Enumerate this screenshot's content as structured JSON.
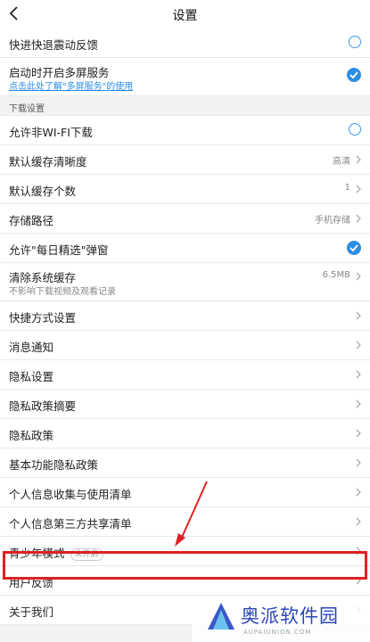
{
  "header": {
    "title": "设置"
  },
  "colors": {
    "accent": "#2d8fe3",
    "highlight": "#e02020"
  },
  "rows": [
    {
      "label": "快进快退震动反馈",
      "control": "circle"
    },
    {
      "label": "启动时开启多屏服务",
      "sub": "点击此处了解\"多屏服务\"的使用",
      "control": "check"
    },
    {
      "section": "下载设置"
    },
    {
      "label": "允许非WI-FI下载",
      "control": "circle"
    },
    {
      "label": "默认缓存清晰度",
      "value": "高清",
      "control": "chevron"
    },
    {
      "label": "默认缓存个数",
      "value": "1",
      "control": "chevron"
    },
    {
      "label": "存储路径",
      "value": "手机存储",
      "control": "chevron"
    },
    {
      "label": "允许\"每日精选\"弹窗",
      "control": "check"
    },
    {
      "label": "清除系统缓存",
      "sub": "不影响下载视频及观看记录",
      "value": "6.5MB",
      "control": "chevron"
    },
    {
      "label": "快捷方式设置",
      "control": "chevron"
    },
    {
      "label": "消息通知",
      "control": "chevron"
    },
    {
      "label": "隐私设置",
      "control": "chevron"
    },
    {
      "label": "隐私政策摘要",
      "control": "chevron"
    },
    {
      "label": "隐私政策",
      "control": "chevron"
    },
    {
      "label": "基本功能隐私政策",
      "control": "chevron"
    },
    {
      "label": "个人信息收集与使用清单",
      "control": "chevron"
    },
    {
      "label": "个人信息第三方共享清单",
      "control": "chevron"
    },
    {
      "label": "青少年模式",
      "badge": "未开启",
      "control": "chevron"
    },
    {
      "label": "用户反馈",
      "control": "chevron"
    },
    {
      "label": "关于我们",
      "control": "chevron"
    }
  ],
  "watermark": {
    "text": "奥派软件园",
    "sub": "AUPAIUNION.COM"
  }
}
